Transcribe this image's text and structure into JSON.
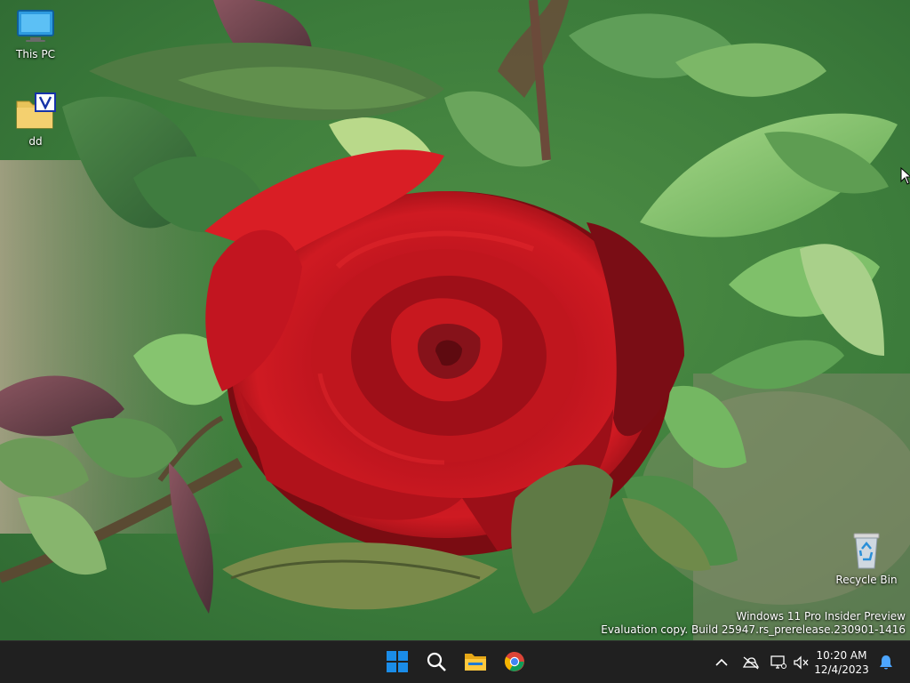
{
  "desktop": {
    "icons": [
      {
        "label": "This PC",
        "icon": "monitor-icon"
      },
      {
        "label": "dd",
        "icon": "folder-shortcut-icon"
      },
      {
        "label": "Recycle Bin",
        "icon": "recycle-bin-icon"
      }
    ],
    "watermark": {
      "line1": "Windows 11 Pro Insider Preview",
      "line2": "Evaluation copy. Build 25947.rs_prerelease.230901-1416"
    }
  },
  "taskbar": {
    "background": "#202020",
    "apps": [
      {
        "icon": "windows-start-icon"
      },
      {
        "icon": "search-icon"
      },
      {
        "icon": "file-explorer-icon"
      },
      {
        "icon": "chrome-icon"
      }
    ],
    "tray": {
      "icons": [
        "chevron-up-icon",
        "network-off-icon",
        "display-icon",
        "volume-muted-icon",
        "notification-bell-icon"
      ],
      "time": "10:20 AM",
      "date": "12/4/2023"
    }
  },
  "colors": {
    "start_blue": "#1a8ce8",
    "folder_yellow": "#f4d06f",
    "rose_red": "#c2111b",
    "leaf_green": "#4d9a45"
  }
}
